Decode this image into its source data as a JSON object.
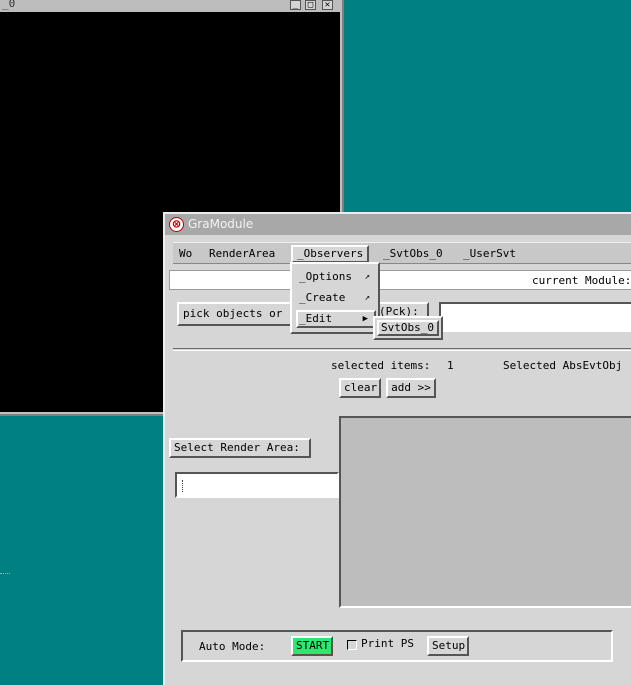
{
  "background_window": {
    "title": "_0",
    "controls": {
      "minimize": "_",
      "maximize": "□",
      "close": "✕"
    }
  },
  "main_window": {
    "title": "GraModule",
    "close_icon": "close-icon",
    "menubar": {
      "items": [
        "Wo",
        "RenderArea",
        "_Observers",
        "_SvtObs_0",
        "_UserSvt"
      ]
    },
    "current_module_label": "current Module:",
    "pick_label": "pick objects or",
    "pick_label_tail": "(Pck):",
    "selected_items_label": "selected items:",
    "selected_items_count": "1",
    "selected_obj_label": "Selected AbsEvtObj",
    "clear_button": "clear",
    "add_button": "add >>",
    "select_render_area_label": "Select Render Area:",
    "auto_mode_label": "Auto Mode:",
    "start_button": "START",
    "print_ps_label": "Print PS",
    "setup_button": "Setup"
  },
  "dropdown": {
    "items": [
      {
        "label": "_Options",
        "arrow": "↗"
      },
      {
        "label": "_Create",
        "arrow": "↗"
      },
      {
        "label": "_Edit",
        "arrow": "▶"
      }
    ],
    "submenu_item": "SvtObs_0"
  },
  "colors": {
    "desktop": "#008080",
    "window_bg": "#d6d6d6",
    "start_button": "#2ee86e"
  }
}
